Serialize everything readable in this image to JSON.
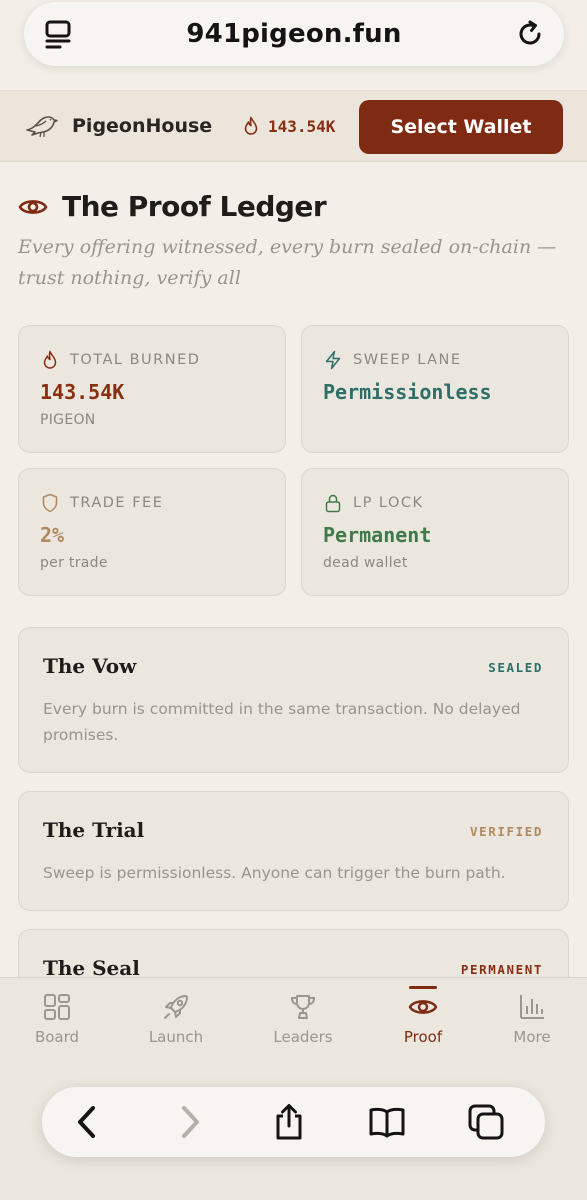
{
  "browser": {
    "url": "941pigeon.fun",
    "tabs_icon": "tabs-icon",
    "reload_icon": "reload-icon",
    "toolbar": [
      "back-icon",
      "forward-icon",
      "share-icon",
      "bookmarks-icon",
      "tabs-overview-icon"
    ]
  },
  "header": {
    "brand_name": "PigeonHouse",
    "brand_icon": "pigeon-logo",
    "burn_total": "143.54K",
    "wallet_button": "Select Wallet"
  },
  "hero": {
    "title": "The Proof Ledger",
    "subtitle": "Every offering witnessed, every burn sealed on-chain — trust nothing, verify all"
  },
  "stats": [
    {
      "icon": "flame-icon",
      "label": "TOTAL BURNED",
      "value": "143.54K",
      "sub": "PIGEON",
      "color": "#8a2e12"
    },
    {
      "icon": "lightning-icon",
      "label": "SWEEP LANE",
      "value": "Permissionless",
      "sub": "",
      "color": "#2f6f69"
    },
    {
      "icon": "shield-icon",
      "label": "TRADE FEE",
      "value": "2%",
      "sub": "per trade",
      "color": "#b08a5e"
    },
    {
      "icon": "lock-icon",
      "label": "LP LOCK",
      "value": "Permanent",
      "sub": "dead wallet",
      "color": "#3f7a48"
    }
  ],
  "proofs": [
    {
      "title": "The Vow",
      "badge": "SEALED",
      "badge_color": "#2f6f69",
      "desc": "Every burn is committed in the same transaction. No delayed promises."
    },
    {
      "title": "The Trial",
      "badge": "VERIFIED",
      "badge_color": "#b08a5e",
      "desc": "Sweep is permissionless. Anyone can trigger the burn path."
    },
    {
      "title": "The Seal",
      "badge": "PERMANENT",
      "badge_color": "#8a2e12",
      "desc": ""
    }
  ],
  "tabs": [
    {
      "label": "Board",
      "icon": "grid-icon",
      "active": false
    },
    {
      "label": "Launch",
      "icon": "rocket-icon",
      "active": false
    },
    {
      "label": "Leaders",
      "icon": "trophy-icon",
      "active": false
    },
    {
      "label": "Proof",
      "icon": "eye-icon",
      "active": true
    },
    {
      "label": "More",
      "icon": "bar-chart-icon",
      "active": false
    }
  ],
  "colors": {
    "accent": "#7f2a12",
    "background": "#f3efe8",
    "card": "#ebe6de",
    "muted": "#9a948c"
  }
}
